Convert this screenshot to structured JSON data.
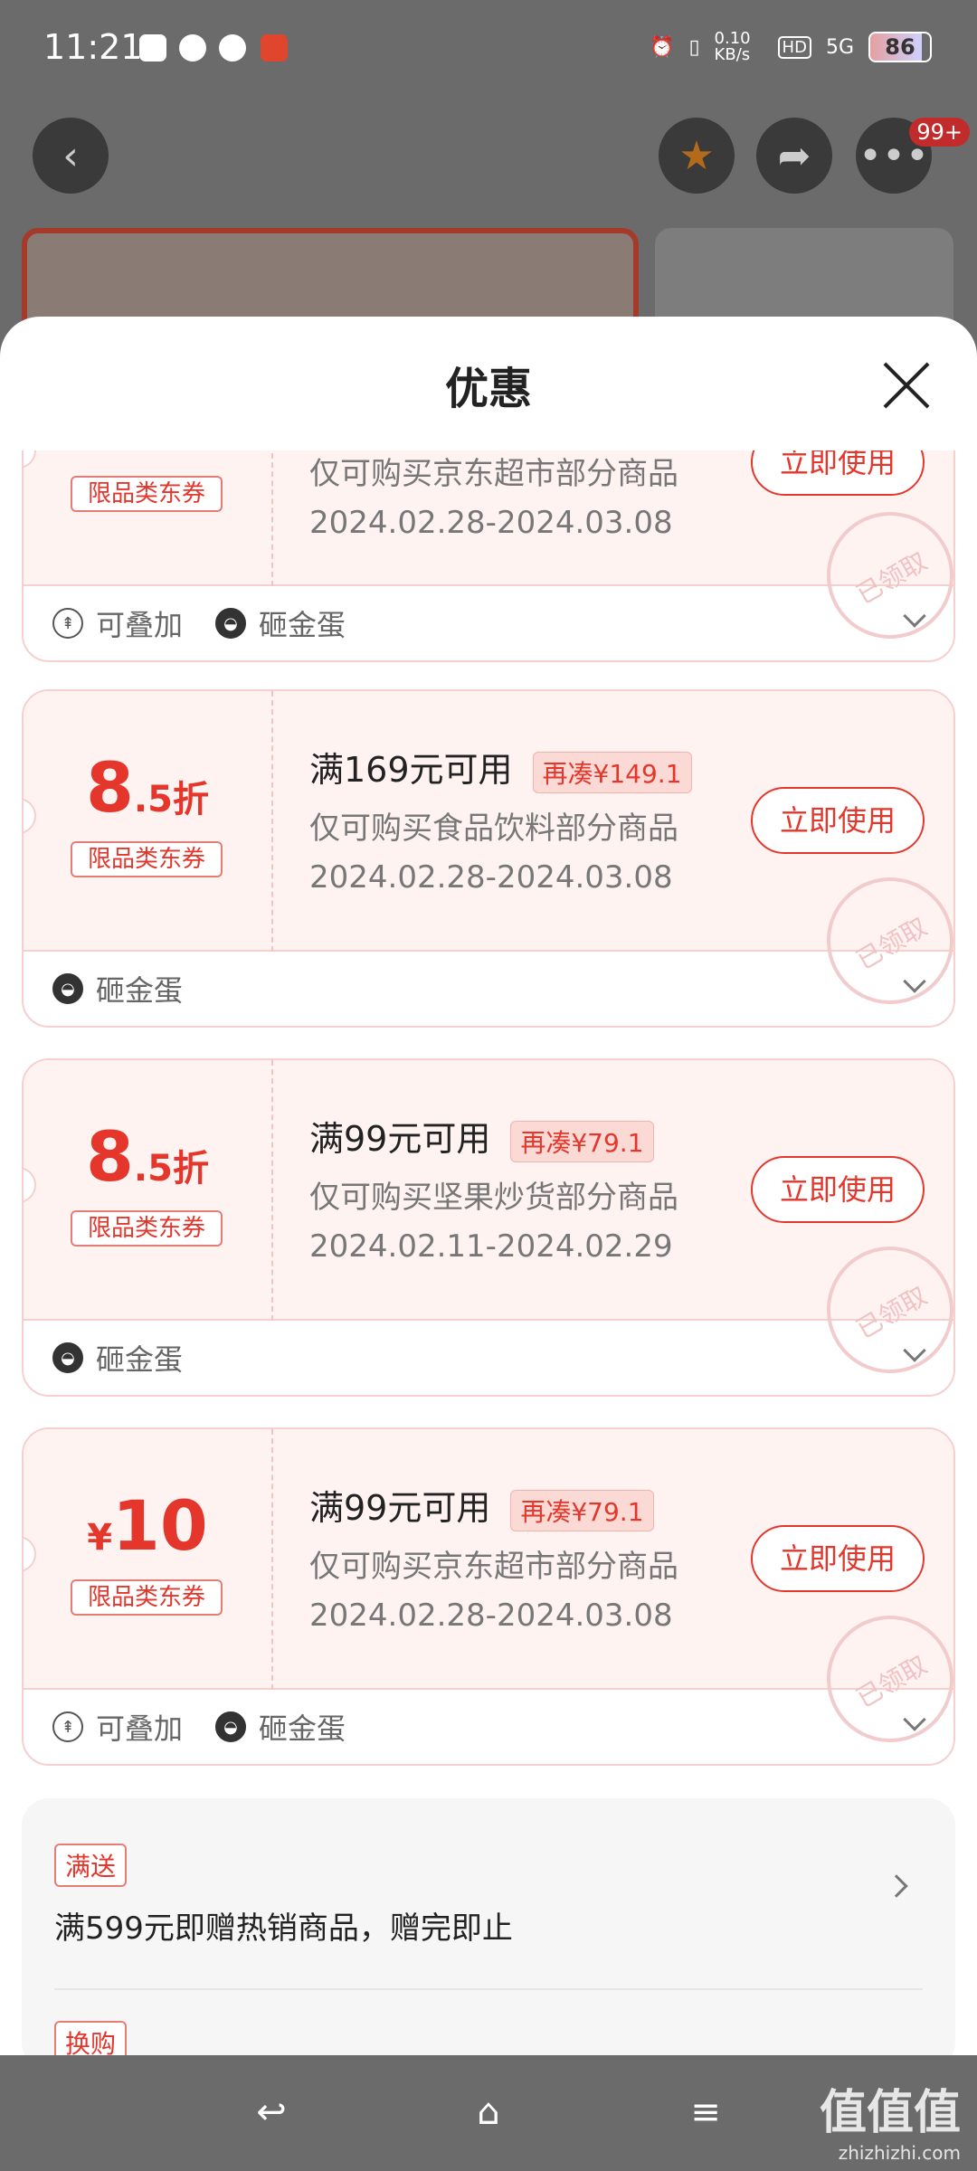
{
  "status_bar": {
    "time": "11:21",
    "net_speed": "0.10 KB/s",
    "net_type": "5G",
    "hd_label": "HD",
    "battery": "86"
  },
  "header": {
    "badge": "99+"
  },
  "sheet": {
    "title": "优惠"
  },
  "coupons": [
    {
      "value_prefix": "",
      "value_main": "",
      "value_suffix": "",
      "tag": "限品类东券",
      "condition": "",
      "extra": "",
      "scope": "仅可购买京东超市部分商品",
      "dates": "2024.02.28-2024.03.08",
      "button": "立即使用",
      "stamp": "已领取",
      "features": [
        "可叠加",
        "砸金蛋"
      ]
    },
    {
      "value_prefix": "",
      "value_main": "8",
      "value_suffix": ".5折",
      "tag": "限品类东券",
      "condition": "满169元可用",
      "extra": "再凑¥149.1",
      "scope": "仅可购买食品饮料部分商品",
      "dates": "2024.02.28-2024.03.08",
      "button": "立即使用",
      "stamp": "已领取",
      "features": [
        "砸金蛋"
      ]
    },
    {
      "value_prefix": "",
      "value_main": "8",
      "value_suffix": ".5折",
      "tag": "限品类东券",
      "condition": "满99元可用",
      "extra": "再凑¥79.1",
      "scope": "仅可购买坚果炒货部分商品",
      "dates": "2024.02.11-2024.02.29",
      "button": "立即使用",
      "stamp": "已领取",
      "features": [
        "砸金蛋"
      ]
    },
    {
      "value_prefix": "¥",
      "value_main": "10",
      "value_suffix": "",
      "tag": "限品类东券",
      "condition": "满99元可用",
      "extra": "再凑¥79.1",
      "scope": "仅可购买京东超市部分商品",
      "dates": "2024.02.28-2024.03.08",
      "button": "立即使用",
      "stamp": "已领取",
      "features": [
        "可叠加",
        "砸金蛋"
      ]
    }
  ],
  "gift": {
    "label": "满送",
    "text": "满599元即赠热销商品，赠完即止",
    "label2": "换购"
  },
  "watermark": {
    "title": "值值值",
    "url": "zhizhizhi.com"
  },
  "colors": {
    "accent": "#e5362c",
    "sheet_bg": "#ffffff",
    "coupon_bg": "#fff3f2"
  }
}
